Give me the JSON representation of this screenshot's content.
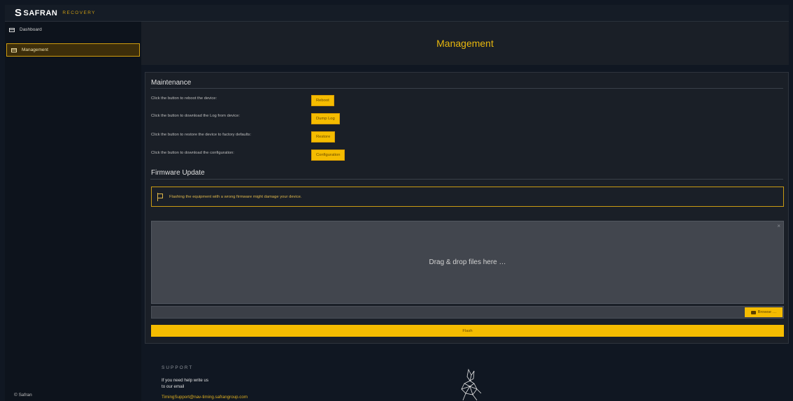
{
  "brand": {
    "name": "SAFRAN",
    "sub": "RECOVERY"
  },
  "sidebar": {
    "items": [
      {
        "label": "Dashboard",
        "icon": "monitor-icon"
      },
      {
        "label": "Management",
        "icon": "window-icon",
        "active": true
      }
    ],
    "footer": "© Safran"
  },
  "header": {
    "title": "Management"
  },
  "maintenance": {
    "title": "Maintenance",
    "rows": [
      {
        "label": "Click the button to reboot the device:",
        "button": "Reboot"
      },
      {
        "label": "Click the button to download the Log from device:",
        "button": "Dump Log"
      },
      {
        "label": "Click the button to restore the device to factory defaults:",
        "button": "Restore"
      },
      {
        "label": "Click the button to download the configuration:",
        "button": "Configuration"
      }
    ]
  },
  "firmware": {
    "title": "Firmware Update",
    "warning": "Flashing the equipment with a wrong firmware might damage your device.",
    "dropzone": "Drag & drop files here …",
    "browse": "Browse …",
    "flash": "Flash"
  },
  "support": {
    "title": "SUPPORT",
    "line1": "If you need help write us",
    "line2": "to our email",
    "email": "TimingSupport@nav-timing.safrangroup.com"
  },
  "colors": {
    "accent": "#f5bc00",
    "accent_text": "#e8b70e",
    "background": "#101722",
    "panel": "#1a1f27"
  }
}
